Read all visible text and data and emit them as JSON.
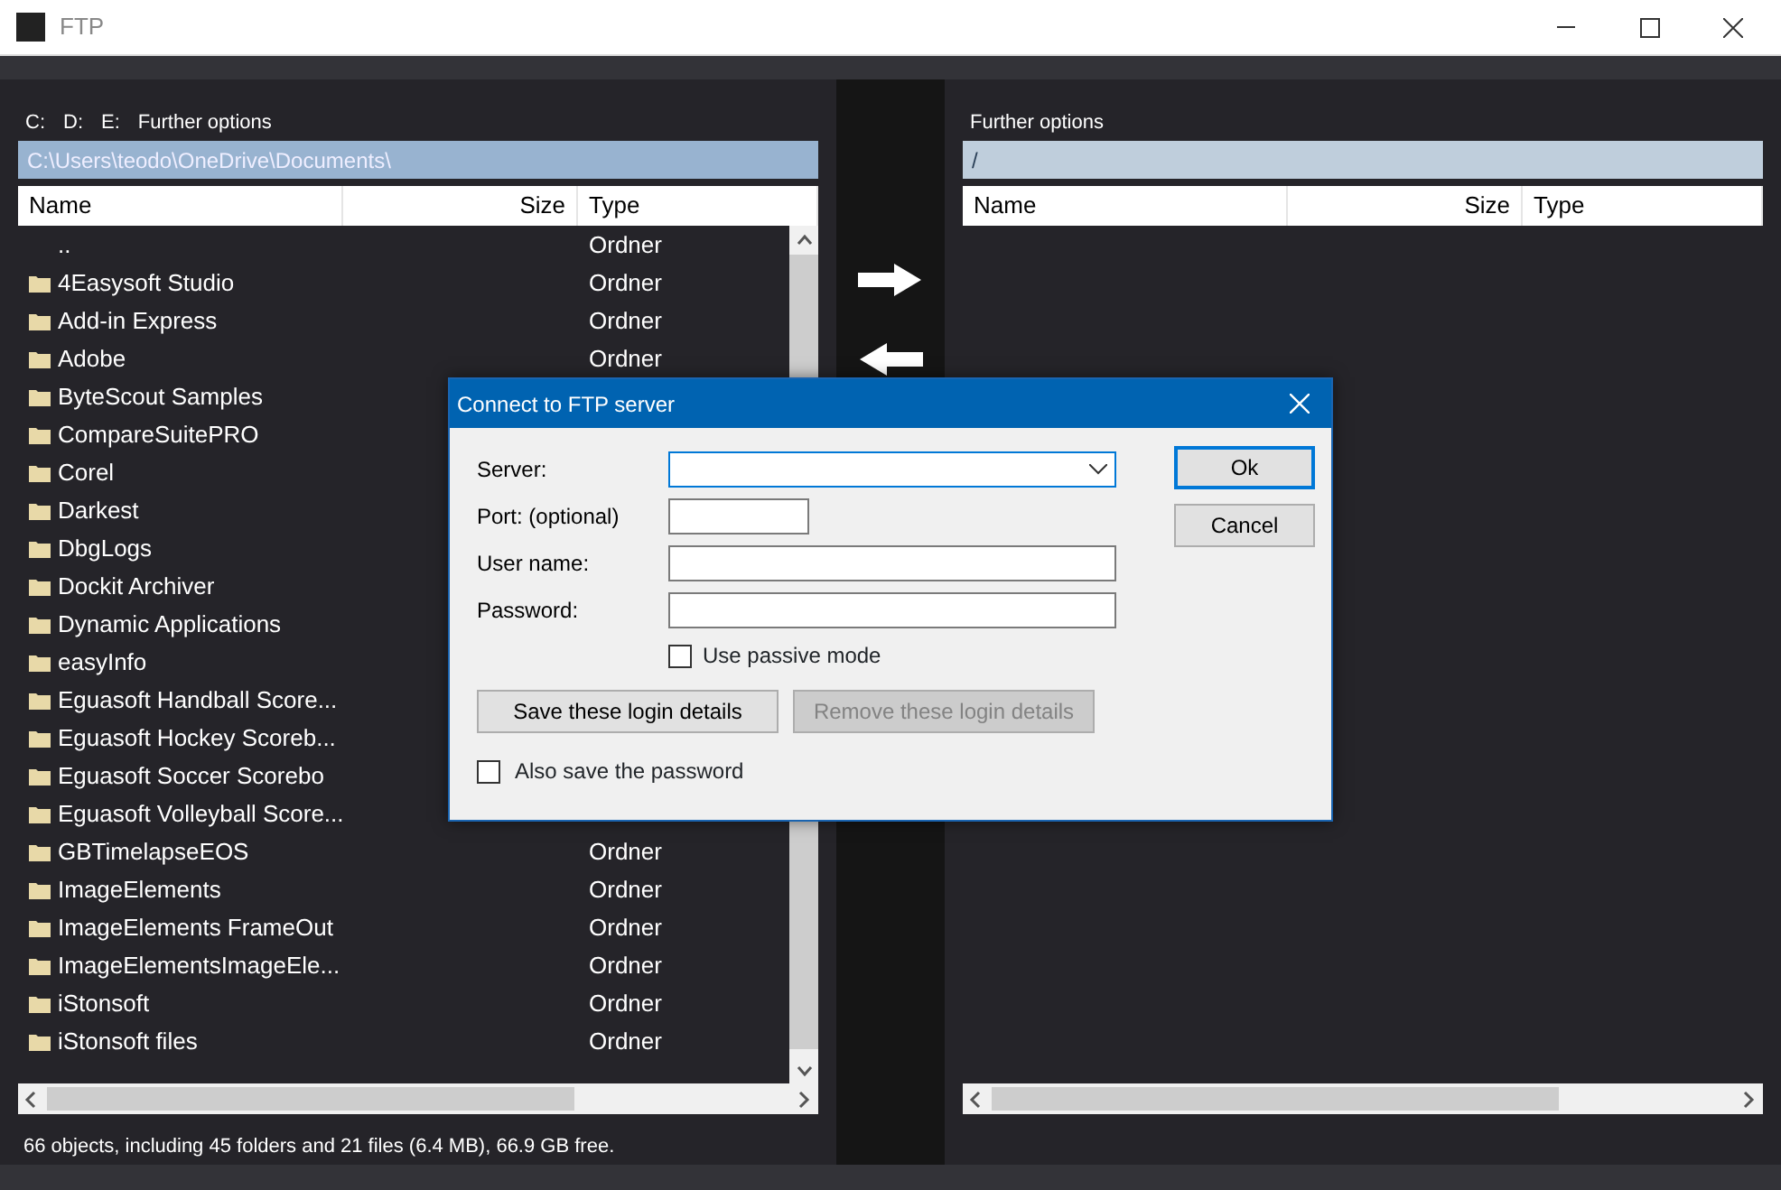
{
  "window": {
    "title": "FTP"
  },
  "left_panel": {
    "drives": [
      "C:",
      "D:",
      "E:"
    ],
    "further_options": "Further options",
    "path": "C:\\Users\\teodo\\OneDrive\\Documents\\",
    "columns": [
      "Name",
      "Size",
      "Type"
    ],
    "rows": [
      {
        "name": "..",
        "type": "Ordner",
        "kind": "parent"
      },
      {
        "name": "4Easysoft Studio",
        "type": "Ordner",
        "kind": "folder"
      },
      {
        "name": "Add-in Express",
        "type": "Ordner",
        "kind": "folder"
      },
      {
        "name": "Adobe",
        "type": "Ordner",
        "kind": "folder"
      },
      {
        "name": "ByteScout Samples",
        "kind": "folder"
      },
      {
        "name": "CompareSuitePRO",
        "kind": "folder"
      },
      {
        "name": "Corel",
        "kind": "folder"
      },
      {
        "name": "Darkest",
        "kind": "folder"
      },
      {
        "name": "DbgLogs",
        "kind": "folder"
      },
      {
        "name": "Dockit Archiver",
        "kind": "folder"
      },
      {
        "name": "Dynamic Applications",
        "kind": "folder"
      },
      {
        "name": "easyInfo",
        "kind": "folder"
      },
      {
        "name": "Eguasoft Handball Score...",
        "kind": "folder"
      },
      {
        "name": "Eguasoft Hockey Scoreb...",
        "kind": "folder"
      },
      {
        "name": "Eguasoft Soccer Scorebo",
        "kind": "folder"
      },
      {
        "name": "Eguasoft Volleyball Score...",
        "kind": "folder"
      },
      {
        "name": "GBTimelapseEOS",
        "type": "Ordner",
        "kind": "folder"
      },
      {
        "name": "ImageElements",
        "type": "Ordner",
        "kind": "folder"
      },
      {
        "name": "ImageElements FrameOut",
        "type": "Ordner",
        "kind": "folder"
      },
      {
        "name": "ImageElementsImageEle...",
        "type": "Ordner",
        "kind": "folder"
      },
      {
        "name": "iStonsoft",
        "type": "Ordner",
        "kind": "folder"
      },
      {
        "name": "iStonsoft files",
        "type": "Ordner",
        "kind": "folder"
      }
    ],
    "status": "66 objects, including 45 folders and 21 files (6.4 MB), 66.9 GB free."
  },
  "right_panel": {
    "further_options": "Further options",
    "path": "/",
    "columns": [
      "Name",
      "Size",
      "Type"
    ]
  },
  "dialog": {
    "title": "Connect to FTP server",
    "fields": [
      {
        "label": "Server:",
        "kind": "combo"
      },
      {
        "label": "Port: (optional)",
        "kind": "short"
      },
      {
        "label": "User name:",
        "kind": "text"
      },
      {
        "label": "Password:",
        "kind": "text"
      }
    ],
    "passive_mode": {
      "label": "Use passive mode",
      "checked": false
    },
    "buttons": [
      {
        "label": "Ok",
        "default": true
      },
      {
        "label": "Cancel",
        "default": false
      }
    ],
    "save_button": {
      "label": "Save these login details",
      "disabled": false
    },
    "remove_button": {
      "label": "Remove these login details",
      "disabled": true
    },
    "save_password": {
      "label": "Also save the password",
      "checked": false
    }
  }
}
